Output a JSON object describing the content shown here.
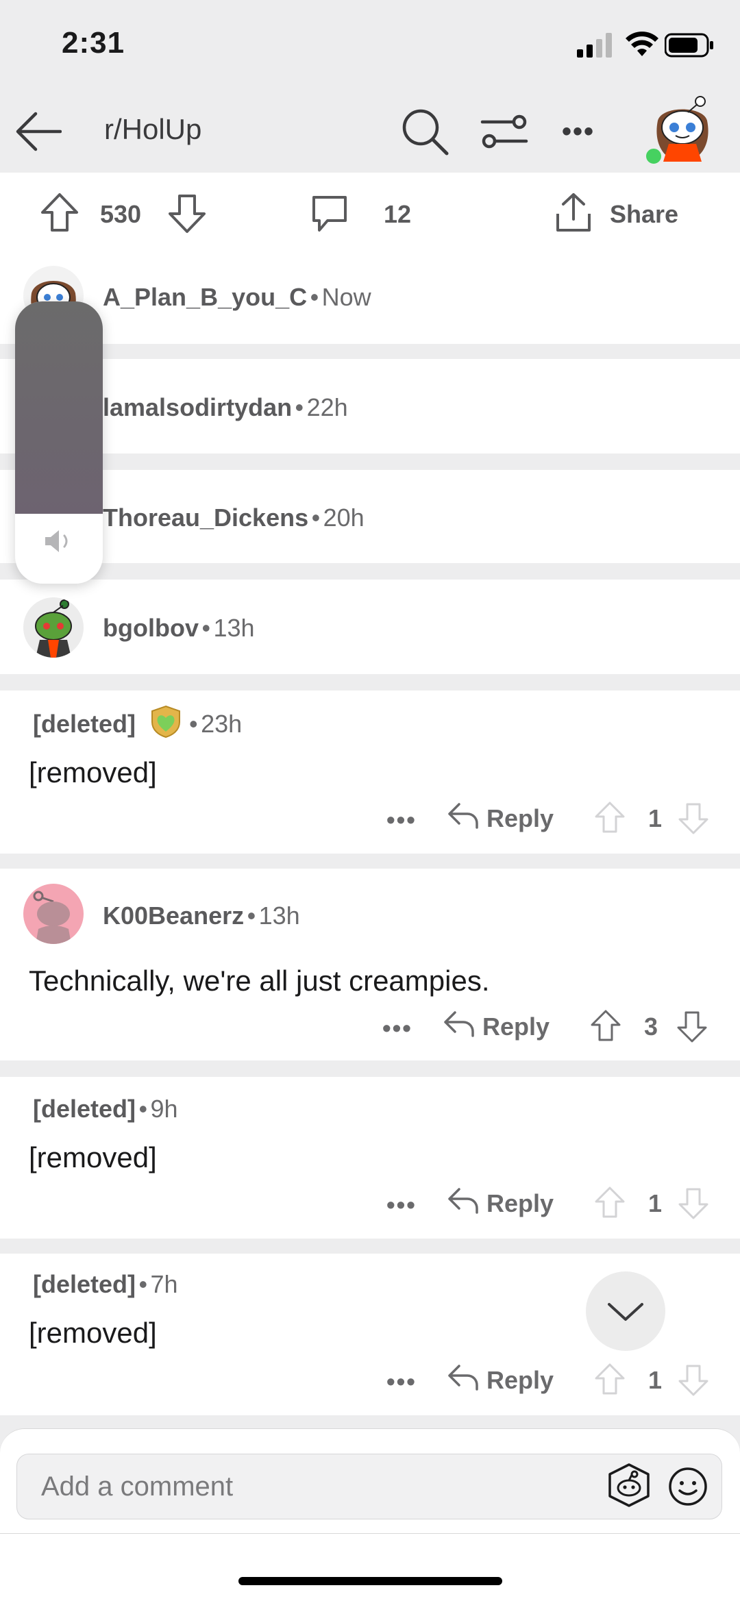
{
  "status_bar": {
    "time": "2:31"
  },
  "header": {
    "subreddit": "r/HolUp"
  },
  "post_actions": {
    "upvotes": "530",
    "comments": "12",
    "share_label": "Share"
  },
  "collapsed_comments": [
    {
      "user": "A_Plan_B_you_C",
      "time": "Now"
    },
    {
      "user": "lamalsodirtydan",
      "time": "22h"
    },
    {
      "user": "Thoreau_Dickens",
      "time": "20h"
    },
    {
      "user": "bgolbov",
      "time": "13h"
    }
  ],
  "comments": [
    {
      "user": "[deleted]",
      "time": "23h",
      "body": "[removed]",
      "reply_label": "Reply",
      "score": "1"
    },
    {
      "user": "K00Beanerz",
      "time": "13h",
      "body": "Technically, we're all just creampies.",
      "reply_label": "Reply",
      "score": "3"
    },
    {
      "user": "[deleted]",
      "time": "9h",
      "body": "[removed]",
      "reply_label": "Reply",
      "score": "1"
    },
    {
      "user": "[deleted]",
      "time": "7h",
      "body": "[removed]",
      "reply_label": "Reply",
      "score": "1"
    }
  ],
  "separator": "•",
  "more_dots": "•••",
  "composer": {
    "placeholder": "Add a comment"
  },
  "colors": {
    "background": "#ededee",
    "card": "#ffffff",
    "text": "#1a1a1b",
    "muted": "#6a6a6c",
    "online": "#46d160"
  }
}
